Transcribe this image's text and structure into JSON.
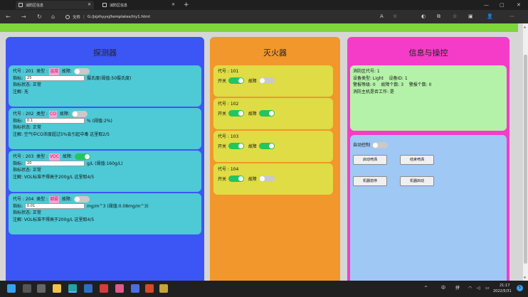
{
  "browser": {
    "tabs": [
      {
        "label": "消防区信息",
        "active": true
      },
      {
        "label": "消防区信息",
        "active": false
      }
    ],
    "new_tab": "+",
    "window_controls": [
      "—",
      "▢",
      "✕"
    ],
    "nav": {
      "back": "←",
      "forward": "→",
      "refresh": "↻",
      "home": "⌂"
    },
    "url_prefix": "文件",
    "url": "G:/jsjzhyysj/templates/try1.html",
    "toolbar_icons": [
      "A",
      "☆",
      "◐",
      "⧉",
      "☆",
      "▣",
      "👤",
      "⋯"
    ]
  },
  "colors": {
    "accent_green": "#7dd63a",
    "detector_panel": "#3b56f5",
    "extinguisher_panel": "#f2972c",
    "info_panel": "#f53cc8"
  },
  "detector_panel": {
    "title": "探测器",
    "detectors": [
      {
        "code_label": "代号 : 201",
        "type_label": "类型 :",
        "type_value": "温度",
        "fault_label": "故障:",
        "fault_on": false,
        "metric_label": "指标:",
        "metric_value": "25",
        "unit_note": "摄氏度(阈值:50摄氏度)",
        "status_label": "指标状态: 正常",
        "note": "注解: 无"
      },
      {
        "code_label": "代号 : 202",
        "type_label": "类型 :",
        "type_value": "CO",
        "fault_label": "故障:",
        "fault_on": false,
        "metric_label": "指标:",
        "metric_value": "0.1",
        "unit_note": "% (阈值:2%)",
        "status_label": "指标状态: 正常",
        "note": "注解: 空气中CO浓度超过5%会引起中毒 这里取2/5"
      },
      {
        "code_label": "代号 : 203",
        "type_label": "类型 :",
        "type_value": "VOC",
        "fault_label": "故障:",
        "fault_on": true,
        "metric_label": "指标:",
        "metric_value": "20",
        "unit_note": "g/L (阈值:160g/L)",
        "status_label": "指标状态: 正常",
        "note": "注解: VOL标准不得高于200g/L 这里取4/5"
      },
      {
        "code_label": "代号 : 204",
        "type_label": "类型 :",
        "type_value": "烟雾",
        "fault_label": "故障:",
        "fault_on": false,
        "metric_label": "指标:",
        "metric_value": "0.01",
        "unit_note": "mg/m^3 (阈值:0.08mg/m^3)",
        "status_label": "指标状态: 正常",
        "note": "注解: VOL标准不得高于200g/L 这里取4/5"
      }
    ]
  },
  "extinguisher_panel": {
    "title": "灭火器",
    "switch_label": "开关",
    "fault_label": "故障",
    "units": [
      {
        "code": "代号 : 101",
        "switch_on": true,
        "fault_on": false
      },
      {
        "code": "代号 : 102",
        "switch_on": true,
        "fault_on": true
      },
      {
        "code": "代号 : 103",
        "switch_on": true,
        "fault_on": true
      },
      {
        "code": "代号 : 104",
        "switch_on": true,
        "fault_on": false
      }
    ]
  },
  "info_panel": {
    "title": "信息与操控",
    "info_lines": [
      "消防区代号: 1",
      "设备类型: Light    设备ID: 1",
      "警报等级: 0    故障个数: 3    警报个数: 0",
      "消防主机是否工作: 是"
    ],
    "auto_control_label": "自动控制",
    "auto_control_on": false,
    "buttons": {
      "start_spray": "启动喷洒",
      "stop_spray": "结束喷洒",
      "stop_machine": "机器熄停",
      "start_machine": "机器启动"
    }
  },
  "taskbar": {
    "tray_arrow": "^",
    "ime_lang": "中",
    "ime_mode": "拼",
    "time": "21:17",
    "date": "2022/5/31",
    "notification_count": "5"
  }
}
